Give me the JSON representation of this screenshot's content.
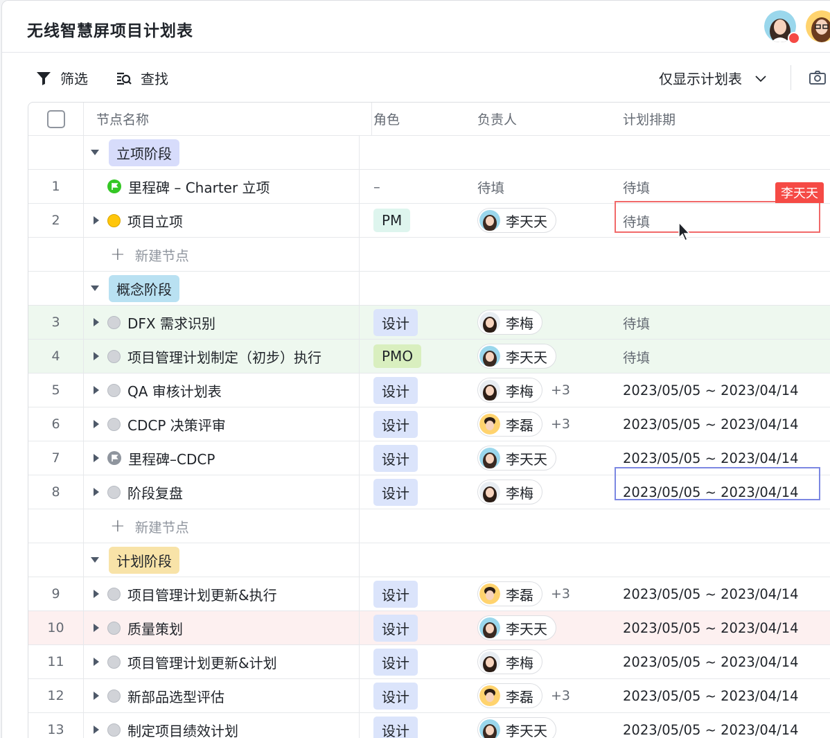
{
  "title": "无线智慧屏项目计划表",
  "toolbar": {
    "filter_label": "筛选",
    "search_label": "查找",
    "view_label": "仅显示计划表"
  },
  "columns": {
    "name": "节点名称",
    "role": "角色",
    "owner": "负责人",
    "plan": "计划排期"
  },
  "add_node_label": "新建节点",
  "editing_user": "李天天",
  "phases": [
    {
      "label": "立项阶段"
    },
    {
      "label": "概念阶段"
    },
    {
      "label": "计划阶段"
    }
  ],
  "rows": [
    {
      "num": "1",
      "name": "里程碑 – Charter 立项",
      "role": "–",
      "owner": "待填",
      "plan": "待填"
    },
    {
      "num": "2",
      "name": "项目立项",
      "role": "PM",
      "owner": "李天天",
      "plan": "待填"
    },
    {
      "num": "3",
      "name": "DFX 需求识别",
      "role": "设计",
      "owner": "李梅",
      "plan": "待填"
    },
    {
      "num": "4",
      "name": "项目管理计划制定（初步）执行",
      "role": "PMO",
      "owner": "李天天",
      "plan": "待填"
    },
    {
      "num": "5",
      "name": "QA 审核计划表",
      "role": "设计",
      "owner": "李梅",
      "extra": "+3",
      "plan": "2023/05/05 ~ 2023/04/14"
    },
    {
      "num": "6",
      "name": "CDCP 决策评审",
      "role": "设计",
      "owner": "李磊",
      "extra": "+3",
      "plan": "2023/05/05 ~ 2023/04/14"
    },
    {
      "num": "7",
      "name": "里程碑–CDCP",
      "role": "设计",
      "owner": "李天天",
      "plan": "2023/05/05 ~ 2023/04/14"
    },
    {
      "num": "8",
      "name": "阶段复盘",
      "role": "设计",
      "owner": "李梅",
      "plan": "2023/05/05 ~ 2023/04/14"
    },
    {
      "num": "9",
      "name": "项目管理计划更新&执行",
      "role": "设计",
      "owner": "李磊",
      "extra": "+3",
      "plan": "2023/05/05 ~ 2023/04/14"
    },
    {
      "num": "10",
      "name": "质量策划",
      "role": "设计",
      "owner": "李天天",
      "plan": "2023/05/05 ~ 2023/04/14"
    },
    {
      "num": "11",
      "name": "项目管理计划更新&计划",
      "role": "设计",
      "owner": "李梅",
      "plan": "2023/05/05 ~ 2023/04/14"
    },
    {
      "num": "12",
      "name": "新部品选型评估",
      "role": "设计",
      "owner": "李磊",
      "extra": "+3",
      "plan": "2023/05/05 ~ 2023/04/14"
    },
    {
      "num": "13",
      "name": "制定项目绩效计划",
      "role": "设计",
      "owner": "李天天",
      "plan": "2023/05/05 ~ 2023/04/14"
    }
  ],
  "colors": {
    "accent_red": "#f54a45",
    "selection_blue": "#7b87e2",
    "row_green": "#eef8ef",
    "row_pink": "#fdf0f0"
  },
  "icons": [
    "filter-icon",
    "search-list-icon",
    "chevron-down-icon",
    "camera-icon",
    "milestone-flag-icon",
    "cursor-icon"
  ]
}
